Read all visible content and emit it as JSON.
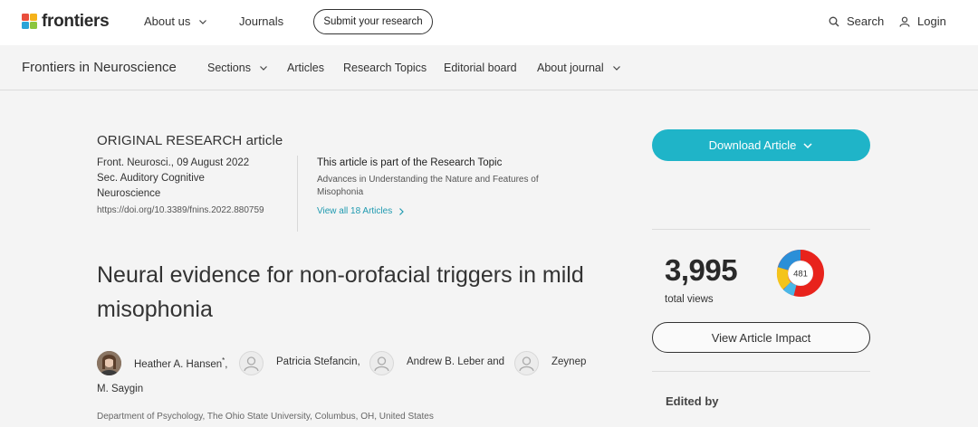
{
  "topnav": {
    "logo_text": "frontiers",
    "about_label": "About us",
    "journals_label": "Journals",
    "submit_label": "Submit your research",
    "search_label": "Search",
    "login_label": "Login"
  },
  "secnav": {
    "journal_name": "Frontiers in Neuroscience",
    "sections_label": "Sections",
    "articles_label": "Articles",
    "research_topics_label": "Research Topics",
    "editorial_board_label": "Editorial board",
    "about_journal_label": "About journal"
  },
  "article": {
    "type": "ORIGINAL RESEARCH article",
    "citation": "Front. Neurosci., 09 August 2022",
    "section_line1": "Sec. Auditory Cognitive",
    "section_line2": "Neuroscience",
    "doi": "https://doi.org/10.3389/fnins.2022.880759",
    "topic_heading": "This article is part of the Research Topic",
    "topic_title": "Advances in Understanding the Nature and Features of Misophonia",
    "topic_view_all": "View all 18 Articles",
    "title": "Neural evidence for non-orofacial triggers in mild misophonia",
    "authors": {
      "a1": "Heather A. Hansen",
      "a1_mark": "*",
      "a1_sep": ",",
      "a2": "Patricia Stefancin,",
      "a3": "Andrew B. Leber and",
      "a4_first": "Zeynep",
      "a4_last": "M. Saygin"
    },
    "affiliation": "Department of Psychology, The Ohio State University, Columbus, OH, United States"
  },
  "sidebar": {
    "download_label": "Download Article",
    "views_count": "3,995",
    "views_label": "total views",
    "altmetric_score": "481",
    "impact_label": "View Article Impact",
    "edited_by_label": "Edited by"
  },
  "colors": {
    "accent": "#1fb4c8",
    "link": "#1f9ab0"
  }
}
